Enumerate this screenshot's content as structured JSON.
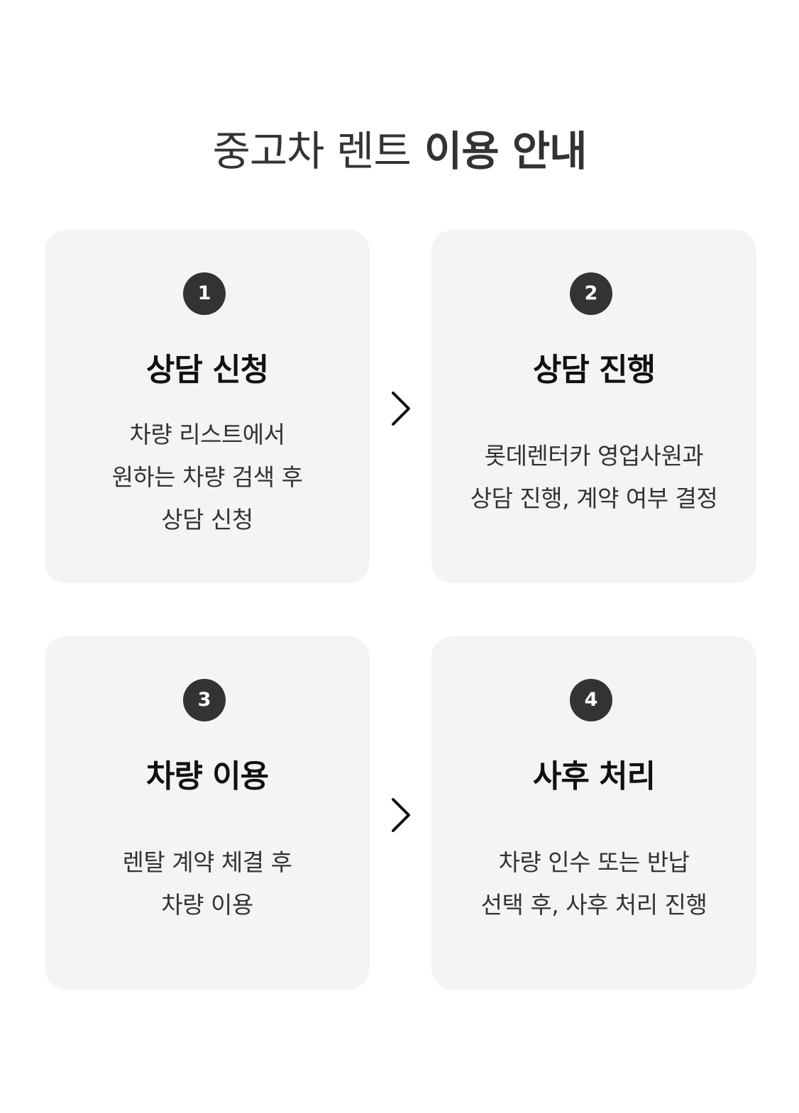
{
  "header": {
    "title_light": "중고차 렌트",
    "title_bold": "이용 안내"
  },
  "steps": [
    {
      "number": "1",
      "title": "상담 신청",
      "description": [
        "차량 리스트에서",
        "원하는 차량 검색 후",
        "상담 신청"
      ]
    },
    {
      "number": "2",
      "title": "상담 진행",
      "description": [
        "롯데렌터카 영업사원과",
        "상담 진행, 계약 여부 결정"
      ]
    },
    {
      "number": "3",
      "title": "차량 이용",
      "description": [
        "렌탈 계약 체결 후",
        "차량 이용"
      ]
    },
    {
      "number": "4",
      "title": "사후 처리",
      "description": [
        "차량 인수 또는 반납",
        "선택 후, 사후 처리 진행"
      ]
    }
  ],
  "icons": {
    "arrow": "chevron-right-icon"
  },
  "colors": {
    "card_background": "#f4f4f4",
    "badge_background": "#333333",
    "badge_text": "#ffffff",
    "title_text": "#333333"
  }
}
